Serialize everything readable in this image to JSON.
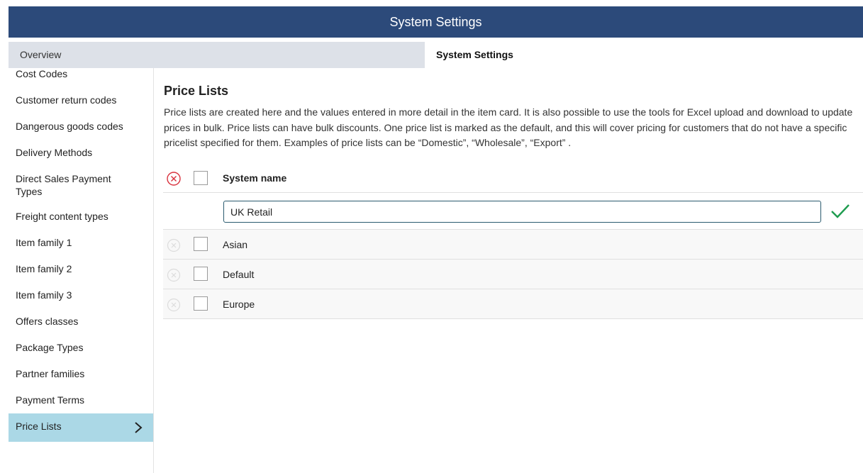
{
  "window": {
    "title": "System Settings"
  },
  "tabs": {
    "overview": "Overview",
    "settings": "System Settings"
  },
  "sidebar": {
    "items": [
      {
        "label": "Cost Codes"
      },
      {
        "label": "Customer return codes"
      },
      {
        "label": "Dangerous goods codes"
      },
      {
        "label": "Delivery Methods"
      },
      {
        "label": "Direct Sales Payment Types"
      },
      {
        "label": "Freight content types"
      },
      {
        "label": "Item family 1"
      },
      {
        "label": "Item family 2"
      },
      {
        "label": "Item family 3"
      },
      {
        "label": "Offers classes"
      },
      {
        "label": "Package Types"
      },
      {
        "label": "Partner families"
      },
      {
        "label": "Payment Terms"
      },
      {
        "label": "Price Lists",
        "active": true
      }
    ]
  },
  "main": {
    "title": "Price Lists",
    "description": "Price lists are created here and the values entered in more detail in the item card. It is also possible to use the tools for Excel upload and download to update prices in bulk. Price lists can have bulk discounts. One price list is marked as the default, and this will cover pricing for customers that do not have a specific pricelist specified for them. Examples of price lists can be “Domestic”, “Wholesale”, “Export” .",
    "table": {
      "column_header": "System name",
      "edit_value": "UK Retail",
      "rows": [
        {
          "name": "Asian"
        },
        {
          "name": "Default"
        },
        {
          "name": "Europe"
        }
      ]
    }
  },
  "colors": {
    "header_bg": "#2c4a7a",
    "tab_inactive_bg": "#dde1e8",
    "active_item_bg": "#abd8e6",
    "delete_red": "#d9333f",
    "confirm_green": "#1e9c4f"
  }
}
